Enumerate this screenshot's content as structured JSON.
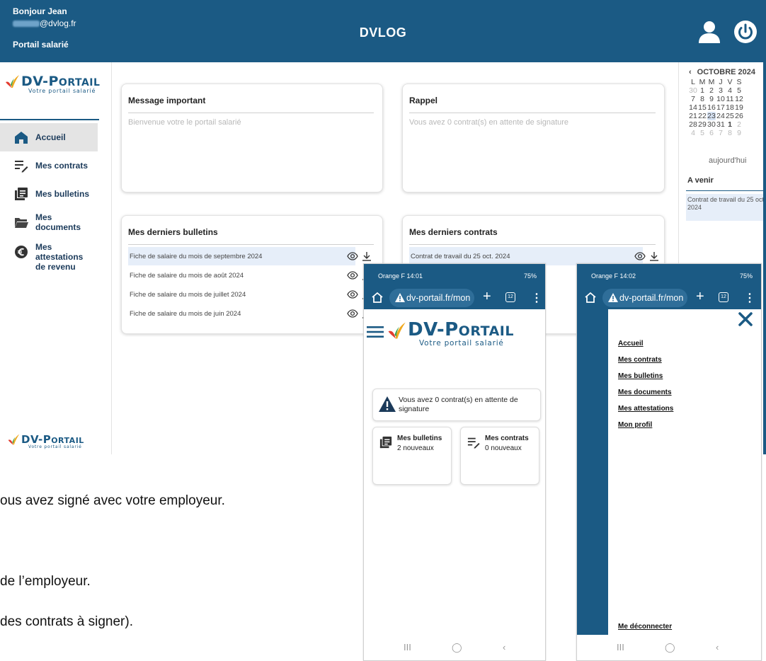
{
  "header": {
    "greeting": "Bonjour Jean",
    "email_domain": "@dvlog.fr",
    "portal_label": "Portail salarié",
    "app_title": "DVLOG",
    "icons": [
      "user-icon",
      "power-icon"
    ]
  },
  "brand": {
    "logo_main_a": "DV-",
    "logo_main_p": "P",
    "logo_main_rest": "ORTAIL",
    "logo_sub": "Votre portail salarié",
    "color": "#1b5a84"
  },
  "sidebar": {
    "items": [
      {
        "label": "Accueil",
        "icon": "home-icon",
        "active": true
      },
      {
        "label": "Mes contrats",
        "icon": "contracts-icon"
      },
      {
        "label": "Mes bulletins",
        "icon": "payslips-icon"
      },
      {
        "label": "Mes documents",
        "icon": "folder-icon"
      },
      {
        "label": "Mes attestations de revenu",
        "line1": "Mes attestations",
        "line2": "de revenu",
        "icon": "euro-icon"
      }
    ]
  },
  "main": {
    "message_card": {
      "title": "Message important",
      "text": "Bienvenue votre le portail salarié"
    },
    "reminder_card": {
      "title": "Rappel",
      "text": "Vous avez 0 contrat(s) en attente de signature"
    },
    "payslips_card": {
      "title": "Mes derniers bulletins",
      "rows": [
        "Fiche de salaire du mois de septembre 2024",
        "Fiche de salaire du mois de août 2024",
        "Fiche de salaire du mois de juillet 2024",
        "Fiche de salaire du mois de juin 2024"
      ]
    },
    "contracts_card": {
      "title": "Mes derniers contrats",
      "rows": [
        "Contrat de travail du 25 oct. 2024"
      ]
    }
  },
  "calendar": {
    "prev": "‹",
    "month": "OCTOBRE 2024",
    "weekdays": [
      "L",
      "M",
      "M",
      "J",
      "V",
      "S"
    ],
    "weeks": [
      [
        "30",
        "1",
        "2",
        "3",
        "4",
        "5"
      ],
      [
        "7",
        "8",
        "9",
        "10",
        "11",
        "12"
      ],
      [
        "14",
        "15",
        "16",
        "17",
        "18",
        "19"
      ],
      [
        "21",
        "22",
        "23",
        "24",
        "25",
        "26"
      ],
      [
        "28",
        "29",
        "30",
        "31",
        "1",
        "2"
      ],
      [
        "4",
        "5",
        "6",
        "7",
        "8",
        "9"
      ]
    ],
    "today_link": "aujourd'hui",
    "upcoming_title": "A venir",
    "upcoming_event": "Contrat de travail du 25 oct 2024"
  },
  "document_text": {
    "line1": "ous avez signé avec votre employeur.",
    "line2": "de l’employeur.",
    "line3": "des contrats à signer)."
  },
  "phone1": {
    "status_left": "Orange F  14:01",
    "status_right": "75%",
    "url": "dv-portail.fr/mon",
    "tab_count": "12",
    "alert_text": "Vous avez 0 contrat(s) en attente de signature",
    "tile1_title": "Mes bulletins",
    "tile1_sub": "2 nouveaux",
    "tile2_title": "Mes contrats",
    "tile2_sub": "0 nouveaux"
  },
  "phone2": {
    "status_left": "Orange F  14:02",
    "status_right": "75%",
    "url": "dv-portail.fr/mon",
    "tab_count": "12",
    "menu": [
      "Accueil",
      "Mes contrats",
      "Mes bulletins",
      "Mes documents",
      "Mes attestations",
      "Mon profil"
    ],
    "logout": "Me déconnecter"
  },
  "phone_nav": {
    "recent": "III",
    "home": "◯",
    "back": "‹"
  }
}
